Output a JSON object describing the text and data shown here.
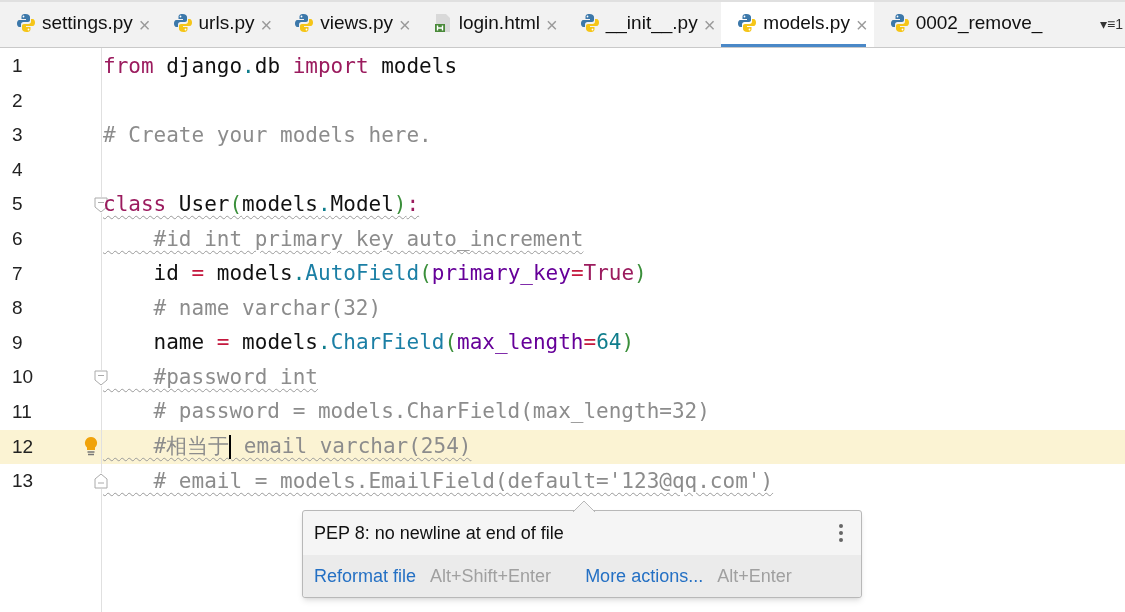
{
  "tabs": [
    {
      "label": "settings.py",
      "kind": "python",
      "selected": false
    },
    {
      "label": "urls.py",
      "kind": "python",
      "selected": false
    },
    {
      "label": "views.py",
      "kind": "python",
      "selected": false
    },
    {
      "label": "login.html",
      "kind": "html",
      "selected": false
    },
    {
      "label": "__init__.py",
      "kind": "python",
      "selected": false
    },
    {
      "label": "models.py",
      "kind": "python",
      "selected": true
    },
    {
      "label": "0002_remove_",
      "kind": "python",
      "selected": false
    }
  ],
  "tab_close_glyph": "×",
  "overflow_label": "▾≡1",
  "lines": [
    {
      "number": "1",
      "current": false,
      "warning": false,
      "tokens": [
        {
          "t": "from",
          "kind": "kw"
        },
        {
          "t": " django",
          "kind": "plain"
        },
        {
          "t": ".",
          "kind": "dot"
        },
        {
          "t": "db ",
          "kind": "plain"
        },
        {
          "t": "import",
          "kind": "kw"
        },
        {
          "t": " models",
          "kind": "plain"
        }
      ]
    },
    {
      "number": "2",
      "current": false
    },
    {
      "number": "3",
      "current": false,
      "warning": false,
      "tokens": [
        {
          "t": "# Create your models here.",
          "kind": "comment"
        }
      ]
    },
    {
      "number": "4",
      "current": false
    },
    {
      "number": "5",
      "current": false,
      "warning": true,
      "fold_start": true,
      "tokens": [
        {
          "t": "class",
          "kind": "kw"
        },
        {
          "t": " User",
          "kind": "plain"
        },
        {
          "t": "(",
          "kind": "paren"
        },
        {
          "t": "models",
          "kind": "plain"
        },
        {
          "t": ".",
          "kind": "dot"
        },
        {
          "t": "Model",
          "kind": "plain"
        },
        {
          "t": ")",
          "kind": "paren"
        },
        {
          "t": ":",
          "kind": "kw"
        }
      ]
    },
    {
      "number": "6",
      "current": false,
      "warning": true,
      "tokens": [
        {
          "t": "    #id int primary key auto_increment",
          "kind": "comment"
        }
      ]
    },
    {
      "number": "7",
      "current": false,
      "warning": false,
      "tokens": [
        {
          "t": "    id ",
          "kind": "plain"
        },
        {
          "t": "=",
          "kind": "op"
        },
        {
          "t": " models",
          "kind": "plain"
        },
        {
          "t": ".",
          "kind": "dot"
        },
        {
          "t": "AutoField",
          "kind": "call"
        },
        {
          "t": "(",
          "kind": "paren"
        },
        {
          "t": "primary_key",
          "kind": "param"
        },
        {
          "t": "=",
          "kind": "op"
        },
        {
          "t": "True",
          "kind": "kw"
        },
        {
          "t": ")",
          "kind": "paren"
        }
      ]
    },
    {
      "number": "8",
      "current": false,
      "warning": false,
      "tokens": [
        {
          "t": "    # name varchar(32)",
          "kind": "comment"
        }
      ]
    },
    {
      "number": "9",
      "current": false,
      "warning": false,
      "tokens": [
        {
          "t": "    name ",
          "kind": "plain"
        },
        {
          "t": "=",
          "kind": "op"
        },
        {
          "t": " models",
          "kind": "plain"
        },
        {
          "t": ".",
          "kind": "dot"
        },
        {
          "t": "CharField",
          "kind": "call"
        },
        {
          "t": "(",
          "kind": "paren"
        },
        {
          "t": "max_length",
          "kind": "param"
        },
        {
          "t": "=",
          "kind": "op"
        },
        {
          "t": "64",
          "kind": "num"
        },
        {
          "t": ")",
          "kind": "paren"
        }
      ]
    },
    {
      "number": "10",
      "current": false,
      "warning": true,
      "fold_start": true,
      "tokens": [
        {
          "t": "    #password int",
          "kind": "comment"
        }
      ]
    },
    {
      "number": "11",
      "current": false,
      "warning": false,
      "tokens": [
        {
          "t": "    # password = models.CharField(max_length=32)",
          "kind": "comment"
        }
      ]
    },
    {
      "number": "12",
      "current": true,
      "warning": true,
      "bulb": true,
      "tokens": [
        {
          "t": "    #相当于",
          "kind": "comment",
          "caret": true
        },
        {
          "t": " email varchar(254)",
          "kind": "comment"
        }
      ]
    },
    {
      "number": "13",
      "current": false,
      "warning": true,
      "fold_end": true,
      "tokens": [
        {
          "t": "    # email = models.EmailField(default='123@qq.com')",
          "kind": "comment"
        }
      ]
    }
  ],
  "popup": {
    "message": "PEP 8: no newline at end of file",
    "actions": [
      {
        "label": "Reformat file",
        "shortcut": "Alt+Shift+Enter"
      },
      {
        "label": "More actions...",
        "shortcut": "Alt+Enter"
      }
    ]
  }
}
